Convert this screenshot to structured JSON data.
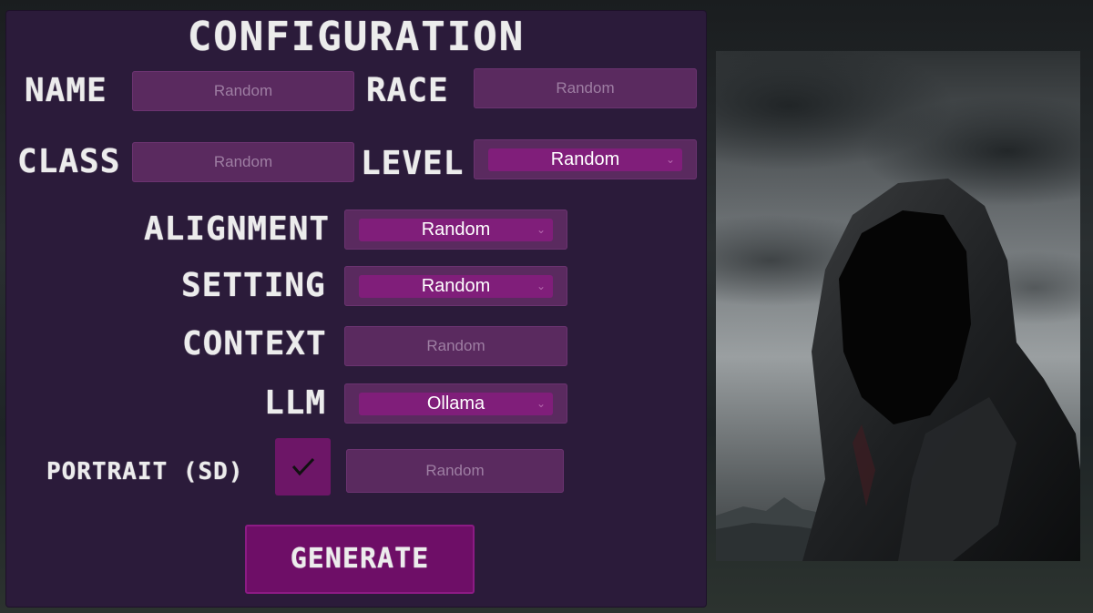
{
  "title": "CONFIGURATION",
  "fields": {
    "name": {
      "label": "NAME",
      "placeholder": "Random"
    },
    "race": {
      "label": "RACE",
      "placeholder": "Random"
    },
    "class": {
      "label": "CLASS",
      "placeholder": "Random"
    },
    "level": {
      "label": "LEVEL",
      "value": "Random"
    },
    "alignment": {
      "label": "ALIGNMENT",
      "value": "Random"
    },
    "setting": {
      "label": "SETTING",
      "value": "Random"
    },
    "context": {
      "label": "CONTEXT",
      "placeholder": "Random"
    },
    "llm": {
      "label": "LLM",
      "value": "Ollama"
    },
    "portrait": {
      "label": "PORTRAIT (SD)",
      "checked": true,
      "placeholder": "Random"
    }
  },
  "generate_label": "GENERATE",
  "colors": {
    "panel": "#2b1b3a",
    "field": "#5a2a5f",
    "dropdown": "#801e7a",
    "button": "#6e0e67"
  }
}
